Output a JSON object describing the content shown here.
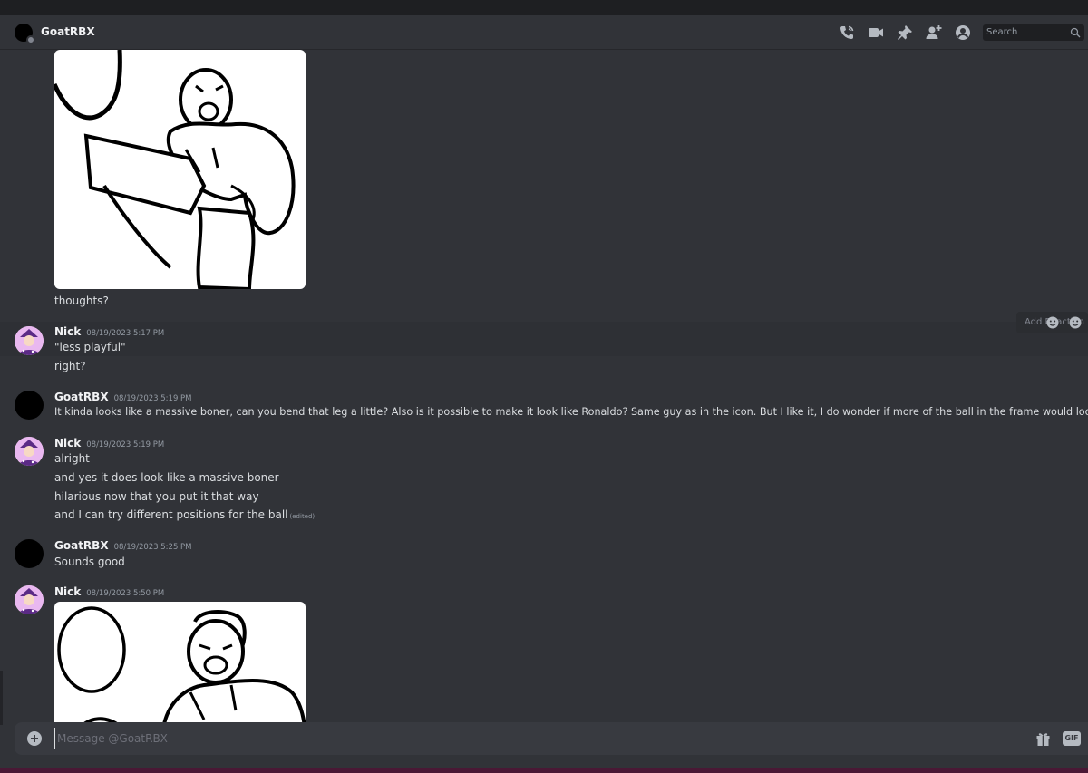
{
  "header": {
    "title": "GoatRBX",
    "search_placeholder": "Search",
    "icons": [
      "phone-call-icon",
      "video-icon",
      "pin-icon",
      "add-friend-icon",
      "profile-icon",
      "search-icon"
    ]
  },
  "messages": {
    "m0": {
      "text": "thoughts?"
    },
    "m1": {
      "author": "Nick",
      "time": "08/19/2023 5:17 PM",
      "lines": [
        "\"less playful\"",
        "right?"
      ]
    },
    "m2": {
      "author": "GoatRBX",
      "time": "08/19/2023 5:19 PM",
      "lines": [
        "It kinda looks like a massive boner, can you bend that leg a little? Also is it possible to make it look like Ronaldo? Same guy as in the icon. But I like it, I do wonder if more of the ball in the frame would look nice?"
      ]
    },
    "m3": {
      "author": "Nick",
      "time": "08/19/2023 5:19 PM",
      "lines": [
        "alright",
        "and yes it does look like a massive boner",
        "hilarious now that you put it that way",
        "and I can try different positions for the ball"
      ],
      "edited": "(edited)"
    },
    "m4": {
      "author": "GoatRBX",
      "time": "08/19/2023 5:25 PM",
      "lines": [
        "Sounds good"
      ]
    },
    "m5": {
      "author": "Nick",
      "time": "08/19/2023 5:50 PM"
    }
  },
  "hover_toolbar": {
    "label": "Add Reaction"
  },
  "composer": {
    "placeholder": "Message @GoatRBX",
    "gif_label": "GIF"
  },
  "colors": {
    "background": "#313338",
    "header": "#313338",
    "composer": "#383a40",
    "text": "#dbdee1",
    "muted": "#949ba4"
  }
}
